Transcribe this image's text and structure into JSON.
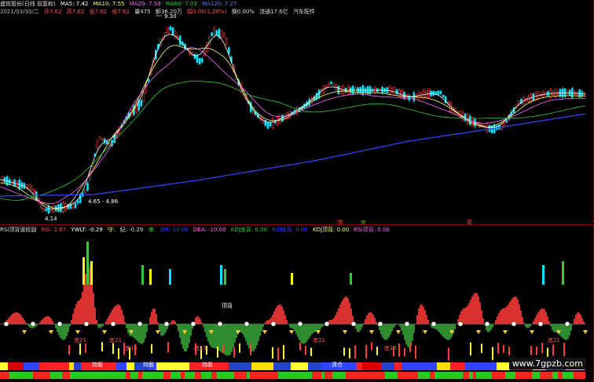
{
  "main_header": {
    "line1": {
      "title": "盛宾股份(日线 前复权)",
      "ma5": "MA5: 7.42",
      "ma10": "MA10: 7.55",
      "ma20": "MA20: 7.59",
      "ma60": "MA60: 7.03",
      "ma120": "MA120: 7.27",
      "right_labels": "9.30"
    },
    "line2": {
      "date": "2021/03/30/二",
      "open": "开7.62",
      "high": "高7.62",
      "low": "低7.62",
      "close": "收7.62",
      "volume": "量475",
      "amount": "额36.20万",
      "change": "幅0.00(1.28%)",
      "turnover": "换0.00%",
      "float": "流通17.6亿",
      "industry": "汽车配件"
    }
  },
  "main_annotations": {
    "high_label": "9.30",
    "low_label1": "4.14",
    "low_label2": "4.65 - 4.86",
    "marker_a": "顶",
    "marker_b": "底",
    "marker_c": "高"
  },
  "indicator_header": {
    "name": "RSI顶背波段副",
    "rsi": "RSI: 2.67",
    "ywlt": "YWLT: -0.29",
    "k1": "守:",
    "k2": "纪: -0.29",
    "k3": "律:",
    "dif": "DIF: 10.00",
    "dea": "DEA: -10.00",
    "kdj_bottom": "KDJ底背: 0.00",
    "rsi_bottom": "RSI底背: 0.00",
    "kdj_top": "KDJ顶背: 0.00",
    "rsi_top": "RSI顶背: 0.00"
  },
  "indicator_labels": {
    "bottom21_a": "底21",
    "bottom21_b": "底21",
    "bottom13_a": "底13",
    "bottom13_b": "底13",
    "bottom13_c": "底13",
    "bottom21_c": "底21",
    "top_back": "顶背",
    "hold_a": "持股",
    "hold_b": "持股",
    "hold_c": "持股",
    "sell": "清仓"
  },
  "watermark": "www.7gpzb.com",
  "colors": {
    "up": "#ff3b3b",
    "down": "#00e5ff",
    "ma5": "#ffffff",
    "ma10": "#ffff66",
    "ma20": "#ff66ff",
    "ma60": "#33cc33",
    "ma120": "#3344ff",
    "area_red": "#d93030",
    "area_green": "#2e8b2e"
  }
}
